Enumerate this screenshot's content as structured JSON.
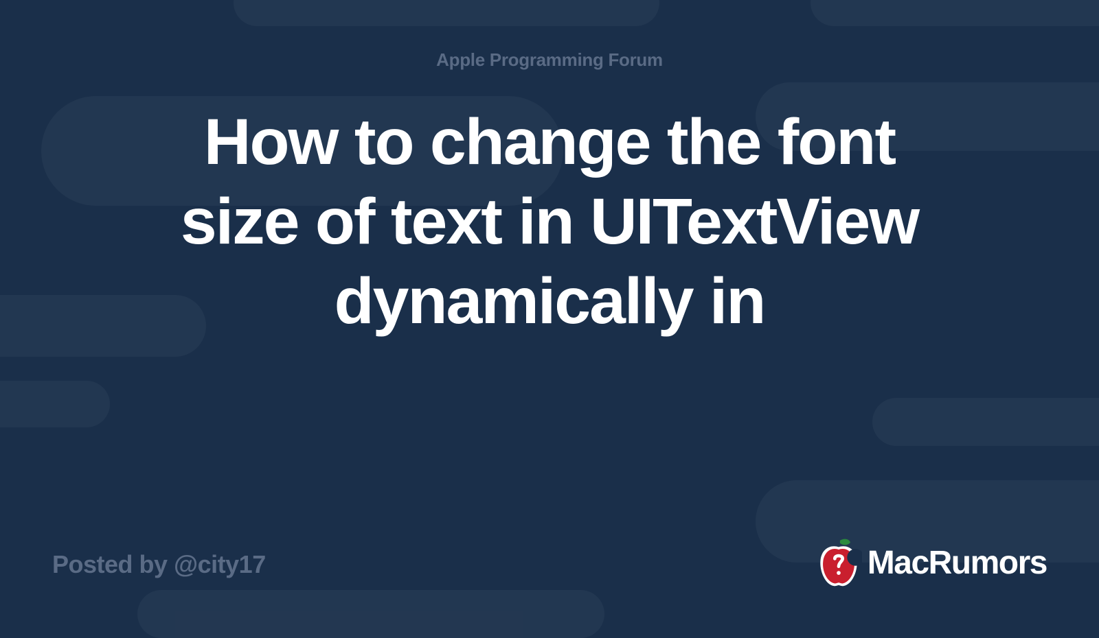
{
  "header": {
    "forum_label": "Apple Programming Forum"
  },
  "thread": {
    "title": "How to change the font size of text in UITextView dynamically in"
  },
  "meta": {
    "posted_by": "Posted by @city17"
  },
  "brand": {
    "name": "MacRumors"
  }
}
